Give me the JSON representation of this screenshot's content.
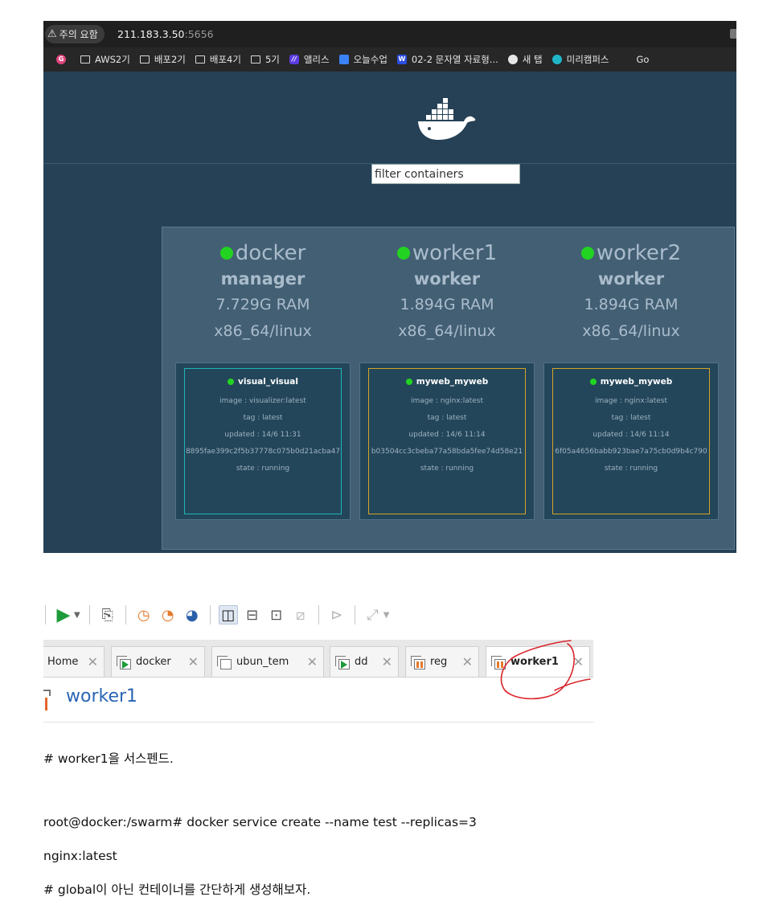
{
  "browser": {
    "security_warning": "주의 요함",
    "url_host": "211.183.3.50",
    "url_port": ":5656",
    "bookmarks": [
      {
        "label": "AWS2기",
        "icon": "folder-icon"
      },
      {
        "label": "배포2기",
        "icon": "folder-icon"
      },
      {
        "label": "배포4기",
        "icon": "folder-icon"
      },
      {
        "label": "5기",
        "icon": "folder-icon"
      },
      {
        "label": "앨리스",
        "icon": "elice-icon"
      },
      {
        "label": "오늘수업",
        "icon": "docs-icon"
      },
      {
        "label": "02-2 문자열 자료형...",
        "icon": "notion-icon"
      },
      {
        "label": "새 탭",
        "icon": "new-tab-icon"
      },
      {
        "label": "미리캠퍼스",
        "icon": "campus-icon"
      },
      {
        "label": "Go",
        "icon": "bookmark-icon"
      }
    ]
  },
  "visualizer": {
    "filter_placeholder": "filter containers",
    "status_color": "#22d322",
    "nodes": [
      {
        "name": "docker",
        "role": "manager",
        "ram": "7.729G RAM",
        "os": "x86_64/linux",
        "task": {
          "name": "visual_visual",
          "image": "image : visualizer:latest",
          "tag": "tag : latest",
          "updated": "updated : 14/6 11:31",
          "id": "8895fae399c2f5b37778c075b0d21acba47",
          "state": "state : running",
          "border_color": "#1fb5b5"
        }
      },
      {
        "name": "worker1",
        "role": "worker",
        "ram": "1.894G RAM",
        "os": "x86_64/linux",
        "task": {
          "name": "myweb_myweb",
          "image": "image : nginx:latest",
          "tag": "tag : latest",
          "updated": "updated : 14/6 11:14",
          "id": "b03504cc3cbeba77a58bda5fee74d58e21",
          "state": "state : running",
          "border_color": "#d4a426"
        }
      },
      {
        "name": "worker2",
        "role": "worker",
        "ram": "1.894G RAM",
        "os": "x86_64/linux",
        "task": {
          "name": "myweb_myweb",
          "image": "image : nginx:latest",
          "tag": "tag : latest",
          "updated": "updated : 14/6 11:14",
          "id": "6f05a4656babb923bae7a75cb0d9b4c790",
          "state": "state : running",
          "border_color": "#d4a426"
        }
      }
    ]
  },
  "vmware": {
    "tabs": [
      {
        "label": "Home",
        "icon": "home-icon",
        "active": false
      },
      {
        "label": "docker",
        "icon": "vm-running-icon",
        "active": false
      },
      {
        "label": "ubun_tem",
        "icon": "vm-off-icon",
        "active": false
      },
      {
        "label": "dd",
        "icon": "vm-running-icon",
        "active": false
      },
      {
        "label": "reg",
        "icon": "vm-suspended-icon",
        "active": false
      },
      {
        "label": "worker1",
        "icon": "vm-suspended-icon",
        "active": true
      }
    ],
    "vm_title": "worker1",
    "annotation_color": "#d9262b"
  },
  "blog": {
    "lines": [
      "# worker1을 서스펜드.",
      "root@docker:/swarm# docker service create --name test --replicas=3",
      "nginx:latest",
      "# global이 아닌 컨테이너를 간단하게 생성해보자."
    ]
  }
}
